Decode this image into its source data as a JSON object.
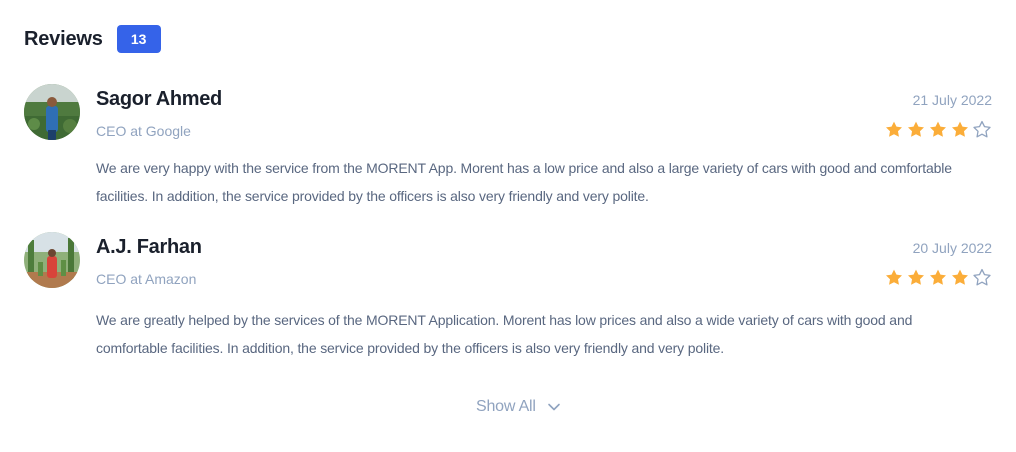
{
  "header": {
    "title": "Reviews",
    "count": "13"
  },
  "colors": {
    "accent": "#3563E9",
    "star_filled": "#FBAD39",
    "star_empty": "#90A3BF",
    "text_primary": "#1A202C",
    "text_secondary": "#90A3BF",
    "text_body": "#596780"
  },
  "reviews": [
    {
      "name": "Sagor Ahmed",
      "role": "CEO at Google",
      "date": "21 July 2022",
      "rating": 4,
      "max_rating": 5,
      "text": "We are very happy with the service from the MORENT App. Morent has a low price and also a large variety of cars with good and comfortable facilities. In addition, the service provided by the officers is also very friendly and very polite.",
      "avatar_icon": "user-photo-avatar"
    },
    {
      "name": "A.J. Farhan",
      "role": "CEO at Amazon",
      "date": "20 July 2022",
      "rating": 4,
      "max_rating": 5,
      "text": "We are greatly helped by the services of the MORENT Application. Morent has low prices and also a wide variety of cars with good and comfortable facilities. In addition, the service provided by the officers is also very friendly and very polite.",
      "avatar_icon": "user-photo-avatar"
    }
  ],
  "footer": {
    "show_all_label": "Show All",
    "show_all_icon": "chevron-down-icon"
  }
}
